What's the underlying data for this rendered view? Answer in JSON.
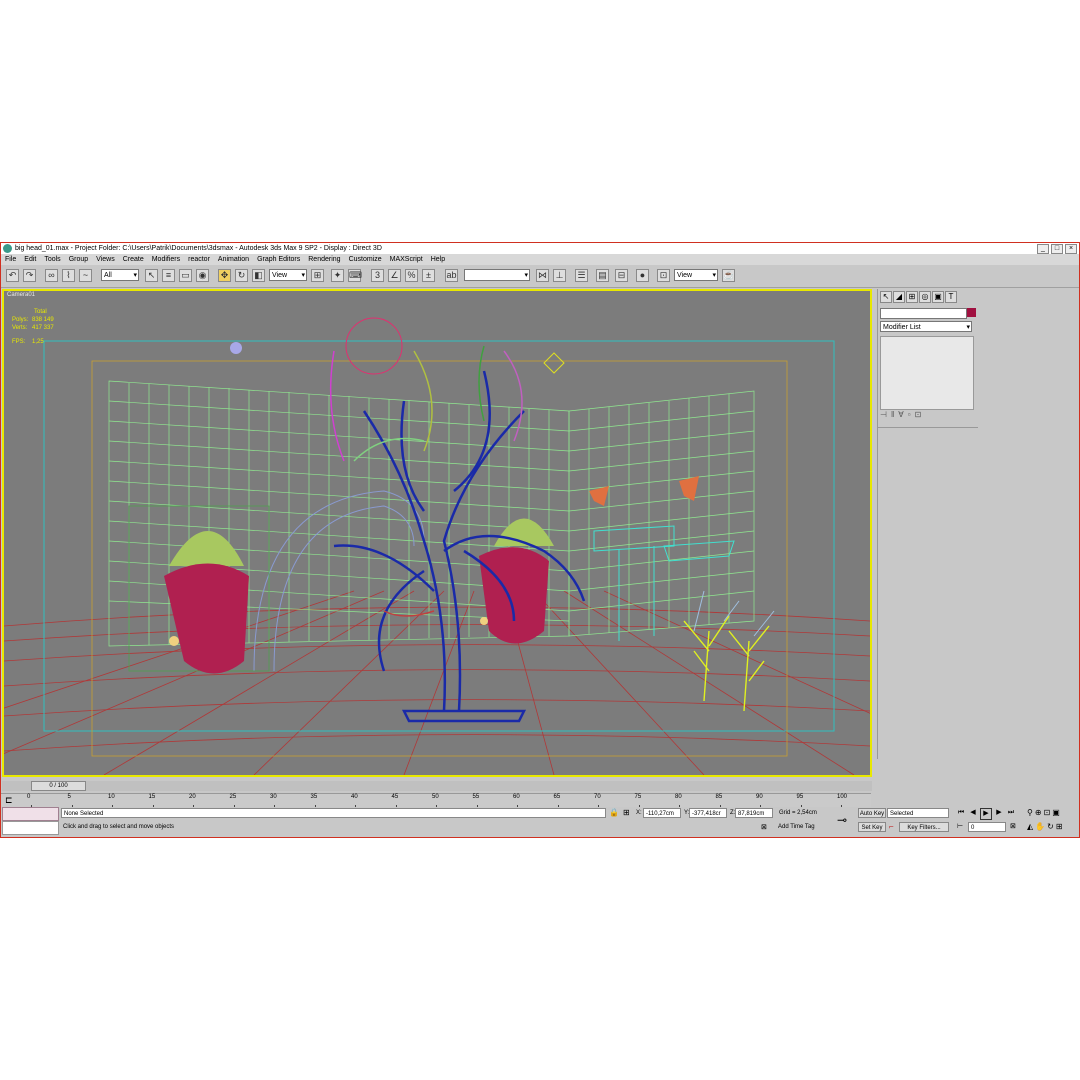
{
  "window": {
    "title": "big head_01.max    - Project Folder: C:\\Users\\Patrik\\Documents\\3dsmax     - Autodesk 3ds Max 9 SP2     - Display : Direct 3D",
    "min": "_",
    "max": "□",
    "close": "×"
  },
  "menu": [
    "File",
    "Edit",
    "Tools",
    "Group",
    "Views",
    "Create",
    "Modifiers",
    "reactor",
    "Animation",
    "Graph Editors",
    "Rendering",
    "Customize",
    "MAXScript",
    "Help"
  ],
  "toolbar": {
    "selection_filter": "All",
    "ref_coord": "View",
    "named_selection": "",
    "viewport_view": "View"
  },
  "viewport": {
    "label": "Camera01",
    "stats_header": "Total",
    "polys_label": "Polys:",
    "polys": "838 149",
    "verts_label": "Verts:",
    "verts": "417 337",
    "fps_label": "FPS:",
    "fps": "1,25",
    "colors": {
      "background": "#7c7c7c",
      "border": "#e8e800",
      "grid": "#b03838"
    }
  },
  "command_panel": {
    "modifier_list": "Modifier List"
  },
  "timeline": {
    "slider": "0 / 100",
    "ticks": [
      "0",
      "5",
      "10",
      "15",
      "20",
      "25",
      "30",
      "35",
      "40",
      "45",
      "50",
      "55",
      "60",
      "65",
      "70",
      "75",
      "80",
      "85",
      "90",
      "95",
      "100"
    ]
  },
  "status": {
    "selection": "None Selected",
    "prompt": "Click and drag to select and move objects",
    "x_label": "X:",
    "x": "-110,27cm",
    "y_label": "Y:",
    "y": "-377,418cr",
    "z_label": "Z:",
    "z": "87,819cm",
    "grid": "Grid = 2,54cm",
    "add_time_tag": "Add Time Tag",
    "auto_key": "Auto Key",
    "set_key": "Set Key",
    "key_mode": "Selected",
    "key_filters": "Key Filters...",
    "frame": "0"
  }
}
